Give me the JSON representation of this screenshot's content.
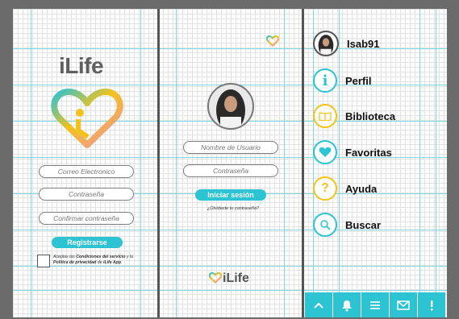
{
  "login_screen": {
    "logo_text": "iLife",
    "register": {
      "email_placeholder": "Correo Electronico",
      "password_placeholder": "Contraseña",
      "confirm_placeholder": "Confirmar contraseña",
      "button_label": "Registrarse",
      "terms_prefix": "Aceptas las ",
      "terms_link1": "Condiciones del servicio",
      "terms_mid": " y la ",
      "terms_link2": "Política de privacidad",
      "terms_mid2": " de ",
      "terms_link3": "iLife App",
      "terms_suffix": "."
    }
  },
  "signin_screen": {
    "username_placeholder": "Nombre de Usuario",
    "password_placeholder": "Contraseña",
    "button_label": "Iniciar sesión",
    "forgot_label": "¿Olvidaste tu contraseña?",
    "bottom_logo_text": "iLife"
  },
  "menu_screen": {
    "items": [
      {
        "label": "Isab91",
        "icon": "avatar",
        "ring": "#2cc3d2"
      },
      {
        "label": "Perfil",
        "icon": "info-icon",
        "ring": "#2cc3d2"
      },
      {
        "label": "Biblioteca",
        "icon": "book-icon",
        "ring": "#f4c21b"
      },
      {
        "label": "Favoritas",
        "icon": "heart-icon",
        "ring": "#2cc3d2"
      },
      {
        "label": "Ayuda",
        "icon": "question-icon",
        "ring": "#f4c21b"
      },
      {
        "label": "Buscar",
        "icon": "search-icon",
        "ring": "#2cc3d2"
      }
    ],
    "bottom_nav": [
      {
        "icon": "chevron-up-icon",
        "glyph": "⌃"
      },
      {
        "icon": "bell-icon",
        "glyph": "🔔"
      },
      {
        "icon": "menu-icon",
        "glyph": "☰"
      },
      {
        "icon": "mail-icon",
        "glyph": "✉"
      },
      {
        "icon": "alert-icon",
        "glyph": "!"
      }
    ]
  },
  "colors": {
    "accent": "#2cc3d2",
    "yellow": "#f4c21b",
    "guide": "#7fd8e4"
  }
}
